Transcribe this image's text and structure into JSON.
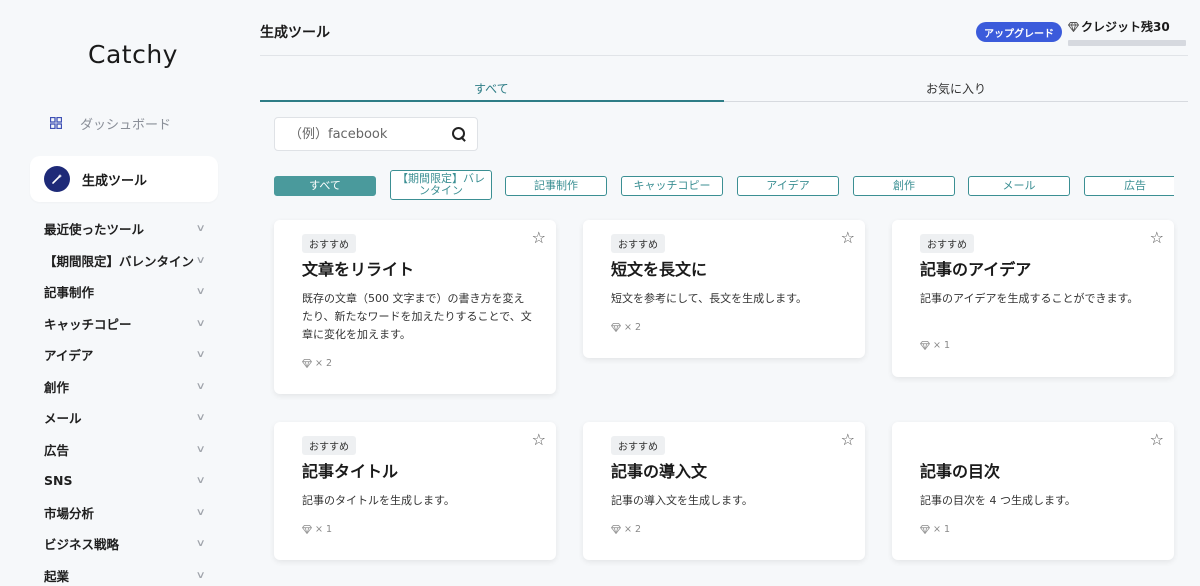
{
  "sidebar": {
    "logo": "Catchy",
    "dashboard_label": "ダッシュボード",
    "tools_label": "生成ツール",
    "categories": [
      {
        "label": "最近使ったツール"
      },
      {
        "label": "【期間限定】バレンタイン"
      },
      {
        "label": "記事制作"
      },
      {
        "label": "キャッチコピー"
      },
      {
        "label": "アイデア"
      },
      {
        "label": "創作"
      },
      {
        "label": "メール"
      },
      {
        "label": "広告"
      },
      {
        "label": "SNS"
      },
      {
        "label": "市場分析"
      },
      {
        "label": "ビジネス戦略"
      },
      {
        "label": "起業"
      }
    ]
  },
  "header": {
    "title": "生成ツール",
    "upgrade_label": "アップグレード",
    "credit_label": "クレジット残30"
  },
  "tabs": [
    {
      "label": "すべて",
      "active": true
    },
    {
      "label": "お気に入り",
      "active": false
    }
  ],
  "search": {
    "placeholder": "（例）facebook",
    "value": ""
  },
  "chips": [
    {
      "label": "すべて",
      "active": true
    },
    {
      "label": "【期間限定】バレンタイン"
    },
    {
      "label": "記事制作"
    },
    {
      "label": "キャッチコピー"
    },
    {
      "label": "アイデア"
    },
    {
      "label": "創作"
    },
    {
      "label": "メール"
    },
    {
      "label": "広告"
    }
  ],
  "cards": [
    {
      "badge": "おすすめ",
      "title": "文章をリライト",
      "desc": "既存の文章（500 文字まで）の書き方を変えたり、新たなワードを加えたりすることで、文章に変化を加えます。",
      "cost": "× 2"
    },
    {
      "badge": "おすすめ",
      "title": "短文を長文に",
      "desc": "短文を参考にして、長文を生成します。",
      "cost": "× 2"
    },
    {
      "badge": "おすすめ",
      "title": "記事のアイデア",
      "desc": "記事のアイデアを生成することができます。",
      "cost": "× 1"
    },
    {
      "badge": "おすすめ",
      "title": "記事タイトル",
      "desc": "記事のタイトルを生成します。",
      "cost": "× 1"
    },
    {
      "badge": "おすすめ",
      "title": "記事の導入文",
      "desc": "記事の導入文を生成します。",
      "cost": "× 2"
    },
    {
      "badge": "",
      "title": "記事の目次",
      "desc": "記事の目次を 4 つ生成します。",
      "cost": "× 1"
    }
  ],
  "colors": {
    "accent_teal": "#2e7d86",
    "chip_active": "#4a9a9c",
    "upgrade_blue": "#3b5bdb",
    "nav_icon_navy": "#1e2a78"
  }
}
